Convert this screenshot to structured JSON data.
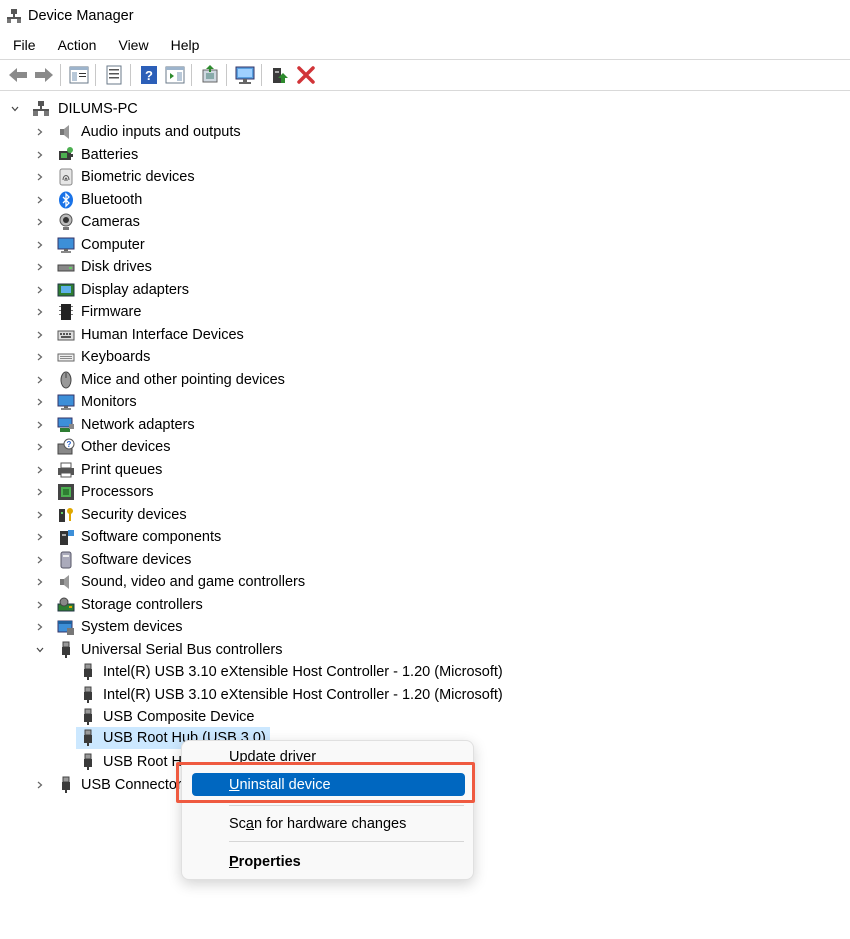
{
  "window": {
    "title": "Device Manager"
  },
  "menu": [
    "File",
    "Action",
    "View",
    "Help"
  ],
  "toolbar": {
    "icons": [
      "back-arrow-icon",
      "forward-arrow-icon",
      "show-hide-tree-icon",
      "properties-icon",
      "help-icon",
      "action-pane-icon",
      "update-driver-icon",
      "scan-hardware-icon",
      "enable-device-icon",
      "uninstall-device-icon"
    ],
    "colors": {
      "uninstall": "#d13438",
      "enable": "#2e8b2e"
    }
  },
  "tree": {
    "root": "DILUMS-PC",
    "categories": [
      "Audio inputs and outputs",
      "Batteries",
      "Biometric devices",
      "Bluetooth",
      "Cameras",
      "Computer",
      "Disk drives",
      "Display adapters",
      "Firmware",
      "Human Interface Devices",
      "Keyboards",
      "Mice and other pointing devices",
      "Monitors",
      "Network adapters",
      "Other devices",
      "Print queues",
      "Processors",
      "Security devices",
      "Software components",
      "Software devices",
      "Sound, video and game controllers",
      "Storage controllers",
      "System devices",
      "Universal Serial Bus controllers"
    ],
    "usb_children": [
      "Intel(R) USB 3.10 eXtensible Host Controller - 1.20 (Microsoft)",
      "Intel(R) USB 3.10 eXtensible Host Controller - 1.20 (Microsoft)",
      "USB Composite Device",
      "USB Root Hub (USB 3.0)",
      "USB Root Hub (USB 3.0)"
    ],
    "last_category": "USB Connector Managers",
    "visible_usb_child_4": "USB Root Hub (USB 3.0)",
    "visible_usb_child_5": "USB Root H",
    "visible_last_category": "USB Connector"
  },
  "context_menu": {
    "items": [
      {
        "label": "Update driver"
      },
      {
        "label_prefix": "",
        "accel": "U",
        "label_rest": "ninstall device"
      },
      {
        "label_prefix": "Sc",
        "accel": "a",
        "label_rest": "n for hardware changes"
      },
      {
        "label_prefix": "",
        "accel": "P",
        "label_rest": "roperties"
      }
    ],
    "highlight_color": "#ef5a40",
    "active_color": "#0067c0"
  }
}
